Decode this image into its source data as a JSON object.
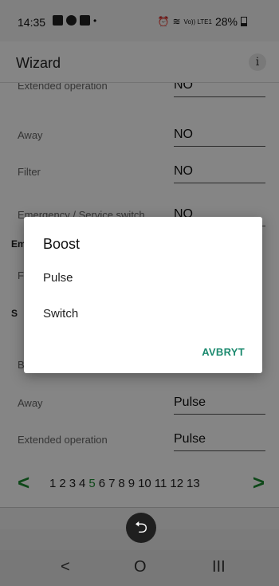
{
  "status_bar": {
    "time": "14:35",
    "signal_text": "Vo)) LTE1",
    "battery": "28%"
  },
  "app_bar": {
    "title": "Wizard",
    "info_glyph": "i"
  },
  "rows_top": [
    {
      "label": "Extended operation",
      "value": "NO"
    },
    {
      "label": "Away",
      "value": "NO"
    },
    {
      "label": "Filter",
      "value": "NO"
    },
    {
      "label": "Emergency / Service switch",
      "value": "NO"
    }
  ],
  "sections": {
    "partial_1": "Em",
    "partial_2": "S"
  },
  "rows_hidden": [
    {
      "label": "F"
    },
    {
      "label": "B"
    }
  ],
  "rows_bottom": [
    {
      "label": "Away",
      "value": "Pulse"
    },
    {
      "label": "Extended operation",
      "value": "Pulse"
    }
  ],
  "pager": {
    "prev": "<",
    "next": ">",
    "pages": [
      "1",
      "2",
      "3",
      "4",
      "5",
      "6",
      "7",
      "8",
      "9",
      "10",
      "11",
      "12",
      "13"
    ],
    "active_page": "5",
    "active_color": "#1c8a30"
  },
  "dialog": {
    "title": "Boost",
    "options": [
      "Pulse",
      "Switch"
    ],
    "cancel_label": "AVBRYT",
    "accent": "#1c8a6f"
  },
  "nav": {
    "back_fab_icon": "undo-arrow-icon",
    "back": "<",
    "home": "O",
    "recents": "III"
  }
}
